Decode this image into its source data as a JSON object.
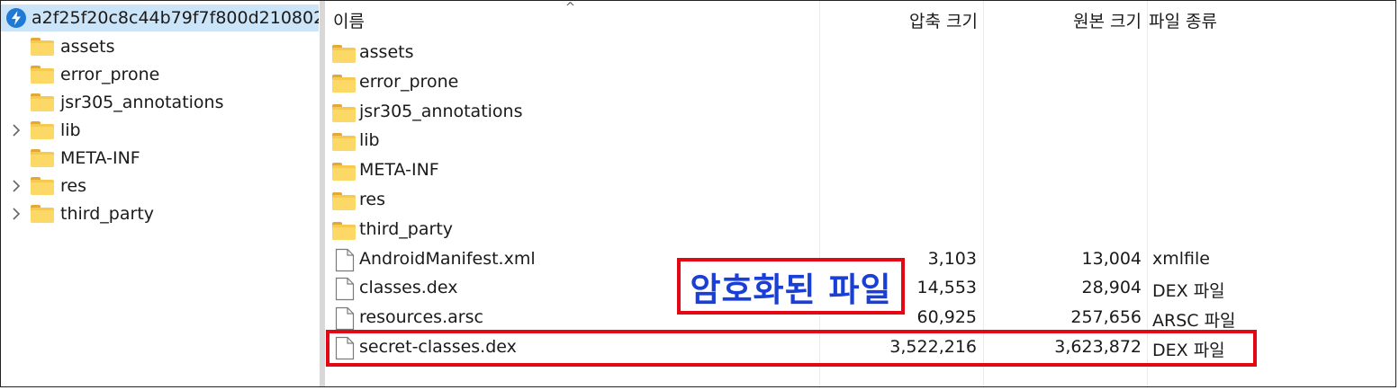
{
  "tree": {
    "root_label": "a2f25f20c8c44b79f7f800d210802",
    "items": [
      {
        "label": "assets",
        "expandable": false
      },
      {
        "label": "error_prone",
        "expandable": false
      },
      {
        "label": "jsr305_annotations",
        "expandable": false
      },
      {
        "label": "lib",
        "expandable": true
      },
      {
        "label": "META-INF",
        "expandable": false
      },
      {
        "label": "res",
        "expandable": true
      },
      {
        "label": "third_party",
        "expandable": true
      }
    ]
  },
  "list": {
    "columns": {
      "name": "이름",
      "compressed": "압축 크기",
      "original": "원본 크기",
      "type": "파일 종류"
    },
    "sort_indicator": "^",
    "rows": [
      {
        "name": "assets",
        "kind": "folder",
        "compressed": "",
        "original": "",
        "type": ""
      },
      {
        "name": "error_prone",
        "kind": "folder",
        "compressed": "",
        "original": "",
        "type": ""
      },
      {
        "name": "jsr305_annotations",
        "kind": "folder",
        "compressed": "",
        "original": "",
        "type": ""
      },
      {
        "name": "lib",
        "kind": "folder",
        "compressed": "",
        "original": "",
        "type": ""
      },
      {
        "name": "META-INF",
        "kind": "folder",
        "compressed": "",
        "original": "",
        "type": ""
      },
      {
        "name": "res",
        "kind": "folder",
        "compressed": "",
        "original": "",
        "type": ""
      },
      {
        "name": "third_party",
        "kind": "folder",
        "compressed": "",
        "original": "",
        "type": ""
      },
      {
        "name": "AndroidManifest.xml",
        "kind": "file",
        "compressed": "3,103",
        "original": "13,004",
        "type": "xmlfile"
      },
      {
        "name": "classes.dex",
        "kind": "file",
        "compressed": "14,553",
        "original": "28,904",
        "type": "DEX 파일"
      },
      {
        "name": "resources.arsc",
        "kind": "file",
        "compressed": "60,925",
        "original": "257,656",
        "type": "ARSC 파일"
      },
      {
        "name": "secret-classes.dex",
        "kind": "file",
        "compressed": "3,522,216",
        "original": "3,623,872",
        "type": "DEX 파일"
      }
    ]
  },
  "annotation": {
    "callout_text": "암호화된 파일",
    "border_color": "#e30613",
    "text_color": "#1a3fd6"
  },
  "icons": {
    "root": "zip-archive-icon",
    "folder": "folder-icon",
    "file": "file-icon",
    "expand": "chevron-right-icon"
  }
}
